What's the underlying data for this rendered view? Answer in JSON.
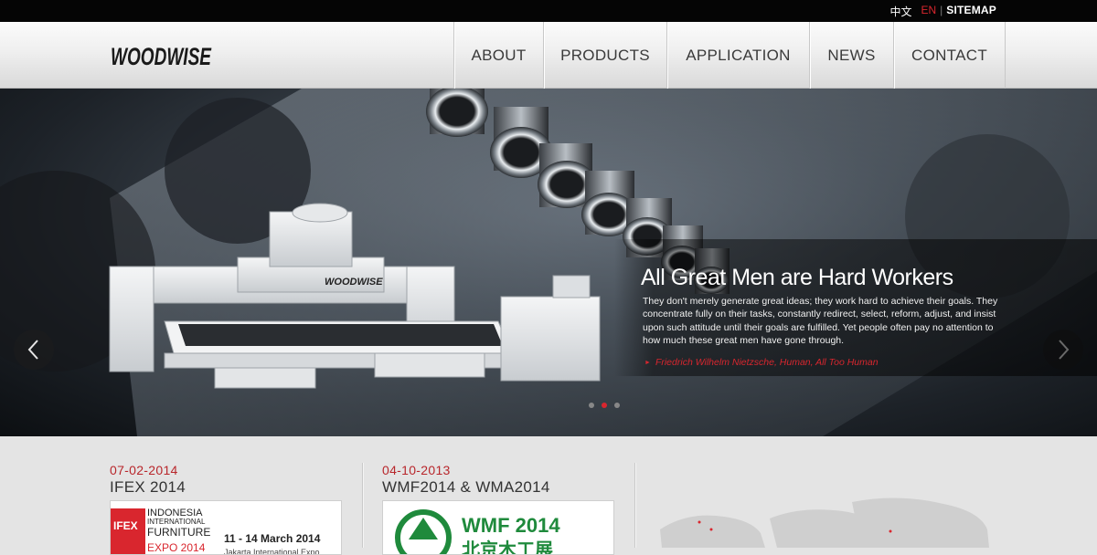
{
  "topbar": {
    "lang_zh": "中文",
    "lang_en": "EN",
    "separator": "|",
    "sitemap": "SITEMAP"
  },
  "header": {
    "logo": "WOODWISE",
    "nav": [
      "ABOUT",
      "PRODUCTS",
      "APPLICATION",
      "NEWS",
      "CONTACT"
    ]
  },
  "hero": {
    "machine_label": "WOODWISE",
    "title": "All Great Men are Hard Workers",
    "body": "They don't merely generate great ideas; they work hard to achieve their goals. They concentrate fully on their tasks, constantly redirect, select, reform, adjust, and insist upon such attitude until their goals are fulfilled. Yet people often pay no attention to how much these great men have gone through.",
    "author": "Friedrich Wilhelm Nietzsche, Human, All Too Human",
    "slides": 3,
    "active_slide": 2
  },
  "news": [
    {
      "date": "07-02-2014",
      "title": "IFEX 2014",
      "thumb": {
        "badge": "IFEX",
        "line1": "INDONESIA",
        "line2": "INTERNATIONAL",
        "line3": "FURNITURE",
        "line4": "EXPO 2014",
        "dates": "11 - 14 March 2014",
        "venue": "Jakarta International Expo"
      }
    },
    {
      "date": "04-10-2013",
      "title": "WMF2014 & WMA2014",
      "thumb": {
        "text": "WMF 2014",
        "sub": "北京木工展"
      }
    }
  ],
  "colors": {
    "accent": "#d9262e",
    "topbar": "#050505",
    "header": "#efefef",
    "body": "#e4e4e4"
  },
  "icons": {
    "prev": "chevron-left-icon",
    "next": "chevron-right-icon"
  }
}
